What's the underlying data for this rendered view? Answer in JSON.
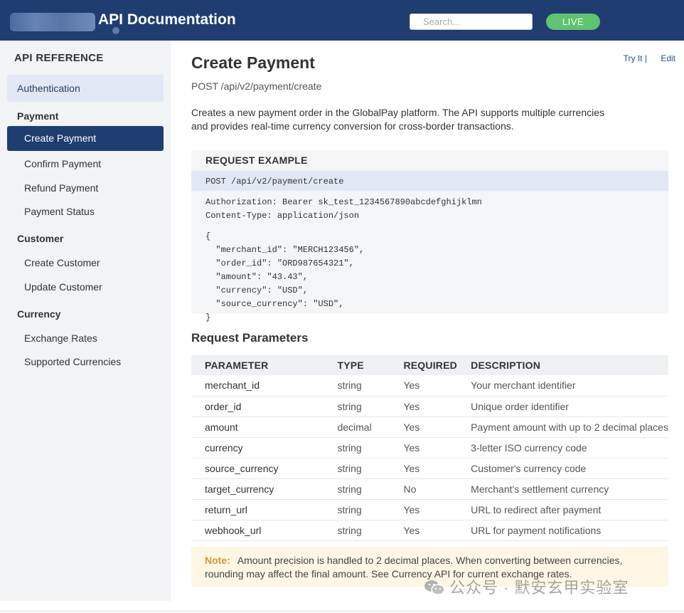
{
  "header": {
    "title": "API Documentation",
    "search_placeholder": "Search...",
    "env_badge": "LIVE"
  },
  "sidebar": {
    "heading": "API REFERENCE",
    "authentication": "Authentication",
    "groups": [
      {
        "label": "Payment",
        "items": [
          "Create Payment",
          "Confirm Payment",
          "Refund Payment",
          "Payment Status"
        ]
      },
      {
        "label": "Customer",
        "items": [
          "Create Customer",
          "Update Customer"
        ]
      },
      {
        "label": "Currency",
        "items": [
          "Exchange Rates",
          "Supported Currencies"
        ]
      }
    ],
    "active_item": "Create Payment"
  },
  "main": {
    "title": "Create Payment",
    "endpoint": "POST /api/v2/payment/create",
    "links": {
      "try_it": "Try It",
      "separator": "|",
      "edit": "Edit"
    },
    "description": "Creates a new payment order in the GlobalPay platform. The API supports multiple currencies and provides real-time currency conversion for cross-border transactions.",
    "request_example": {
      "heading": "REQUEST EXAMPLE",
      "request_line": "POST /api/v2/payment/create",
      "headers": [
        "Authorization: Bearer sk_test_1234567890abcdefghijklmn",
        "Content-Type: application/json"
      ],
      "body_lines": [
        "{",
        "  \"merchant_id\": \"MERCH123456\",",
        "  \"order_id\": \"ORD987654321\",",
        "  \"amount\": \"43.43\",",
        "  \"currency\": \"USD\",",
        "  \"source_currency\": \"USD\",",
        "}"
      ]
    },
    "params_title": "Request Parameters",
    "table": {
      "columns": [
        "PARAMETER",
        "TYPE",
        "REQUIRED",
        "DESCRIPTION"
      ],
      "rows": [
        [
          "merchant_id",
          "string",
          "Yes",
          "Your merchant identifier"
        ],
        [
          "order_id",
          "string",
          "Yes",
          "Unique order identifier"
        ],
        [
          "amount",
          "decimal",
          "Yes",
          "Payment amount with up to 2 decimal places"
        ],
        [
          "currency",
          "string",
          "Yes",
          "3-letter ISO currency code"
        ],
        [
          "source_currency",
          "string",
          "Yes",
          "Customer's currency code"
        ],
        [
          "target_currency",
          "string",
          "No",
          "Merchant's settlement currency"
        ],
        [
          "return_url",
          "string",
          "Yes",
          "URL to redirect after payment"
        ],
        [
          "webhook_url",
          "string",
          "Yes",
          "URL for payment notifications"
        ]
      ]
    },
    "note": {
      "label": "Note:",
      "text": "Amount precision is handled to 2 decimal places. When converting between currencies, rounding may affect the final amount. See Currency API for current exchange rates."
    }
  },
  "watermark": "公众号 · 默安玄甲实验室",
  "colors": {
    "header_bg": "#1f3d70",
    "live_badge": "#5ec46f",
    "active_item": "#1f3d70",
    "note_bg": "#fff6e3",
    "note_label": "#d09a3b"
  }
}
